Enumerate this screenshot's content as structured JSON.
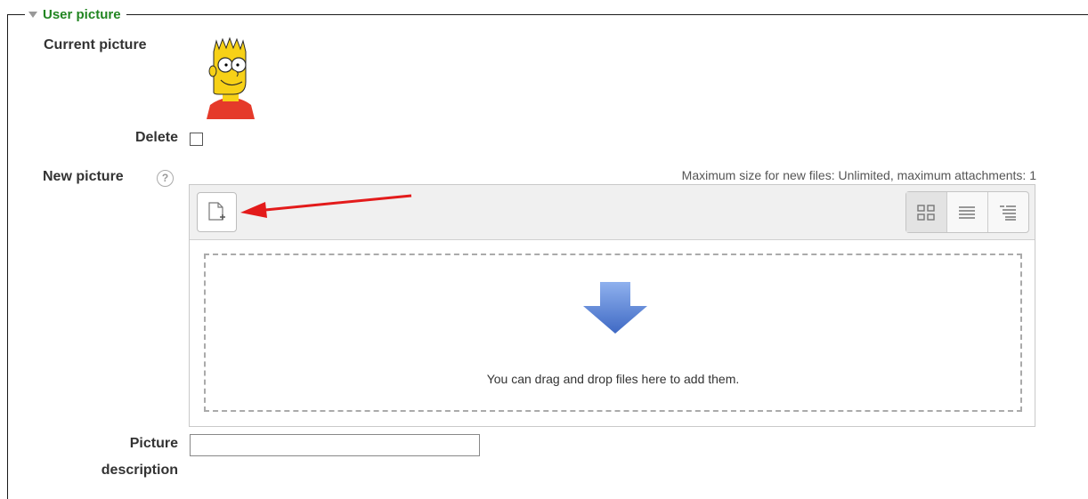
{
  "section": {
    "legend": "User picture",
    "collapse_icon": "triangle-down-icon"
  },
  "current_picture": {
    "label": "Current picture",
    "avatar_icon": "avatar-image"
  },
  "delete": {
    "label": "Delete",
    "checked": false
  },
  "new_picture": {
    "label": "New picture",
    "help_icon": "question-mark-icon",
    "help_glyph": "?",
    "max_size_text": "Maximum size for new files: Unlimited, maximum attachments: 1"
  },
  "file_manager": {
    "add_button_icon": "add-file-icon",
    "view_buttons": [
      {
        "name": "icons-view",
        "icon": "grid-icon",
        "active": true
      },
      {
        "name": "list-view",
        "icon": "list-icon",
        "active": false
      },
      {
        "name": "tree-view",
        "icon": "tree-icon",
        "active": false
      }
    ],
    "dropzone_icon": "down-arrow-icon",
    "dropzone_text": "You can drag and drop files here to add them."
  },
  "picture_description": {
    "label_line1": "Picture",
    "label_line2": "description",
    "value": ""
  },
  "annotation": {
    "icon": "red-arrow-icon"
  },
  "colors": {
    "legend": "#218521",
    "annotation": "#e31b1b",
    "dropzone_arrow": "#5a82d6"
  }
}
